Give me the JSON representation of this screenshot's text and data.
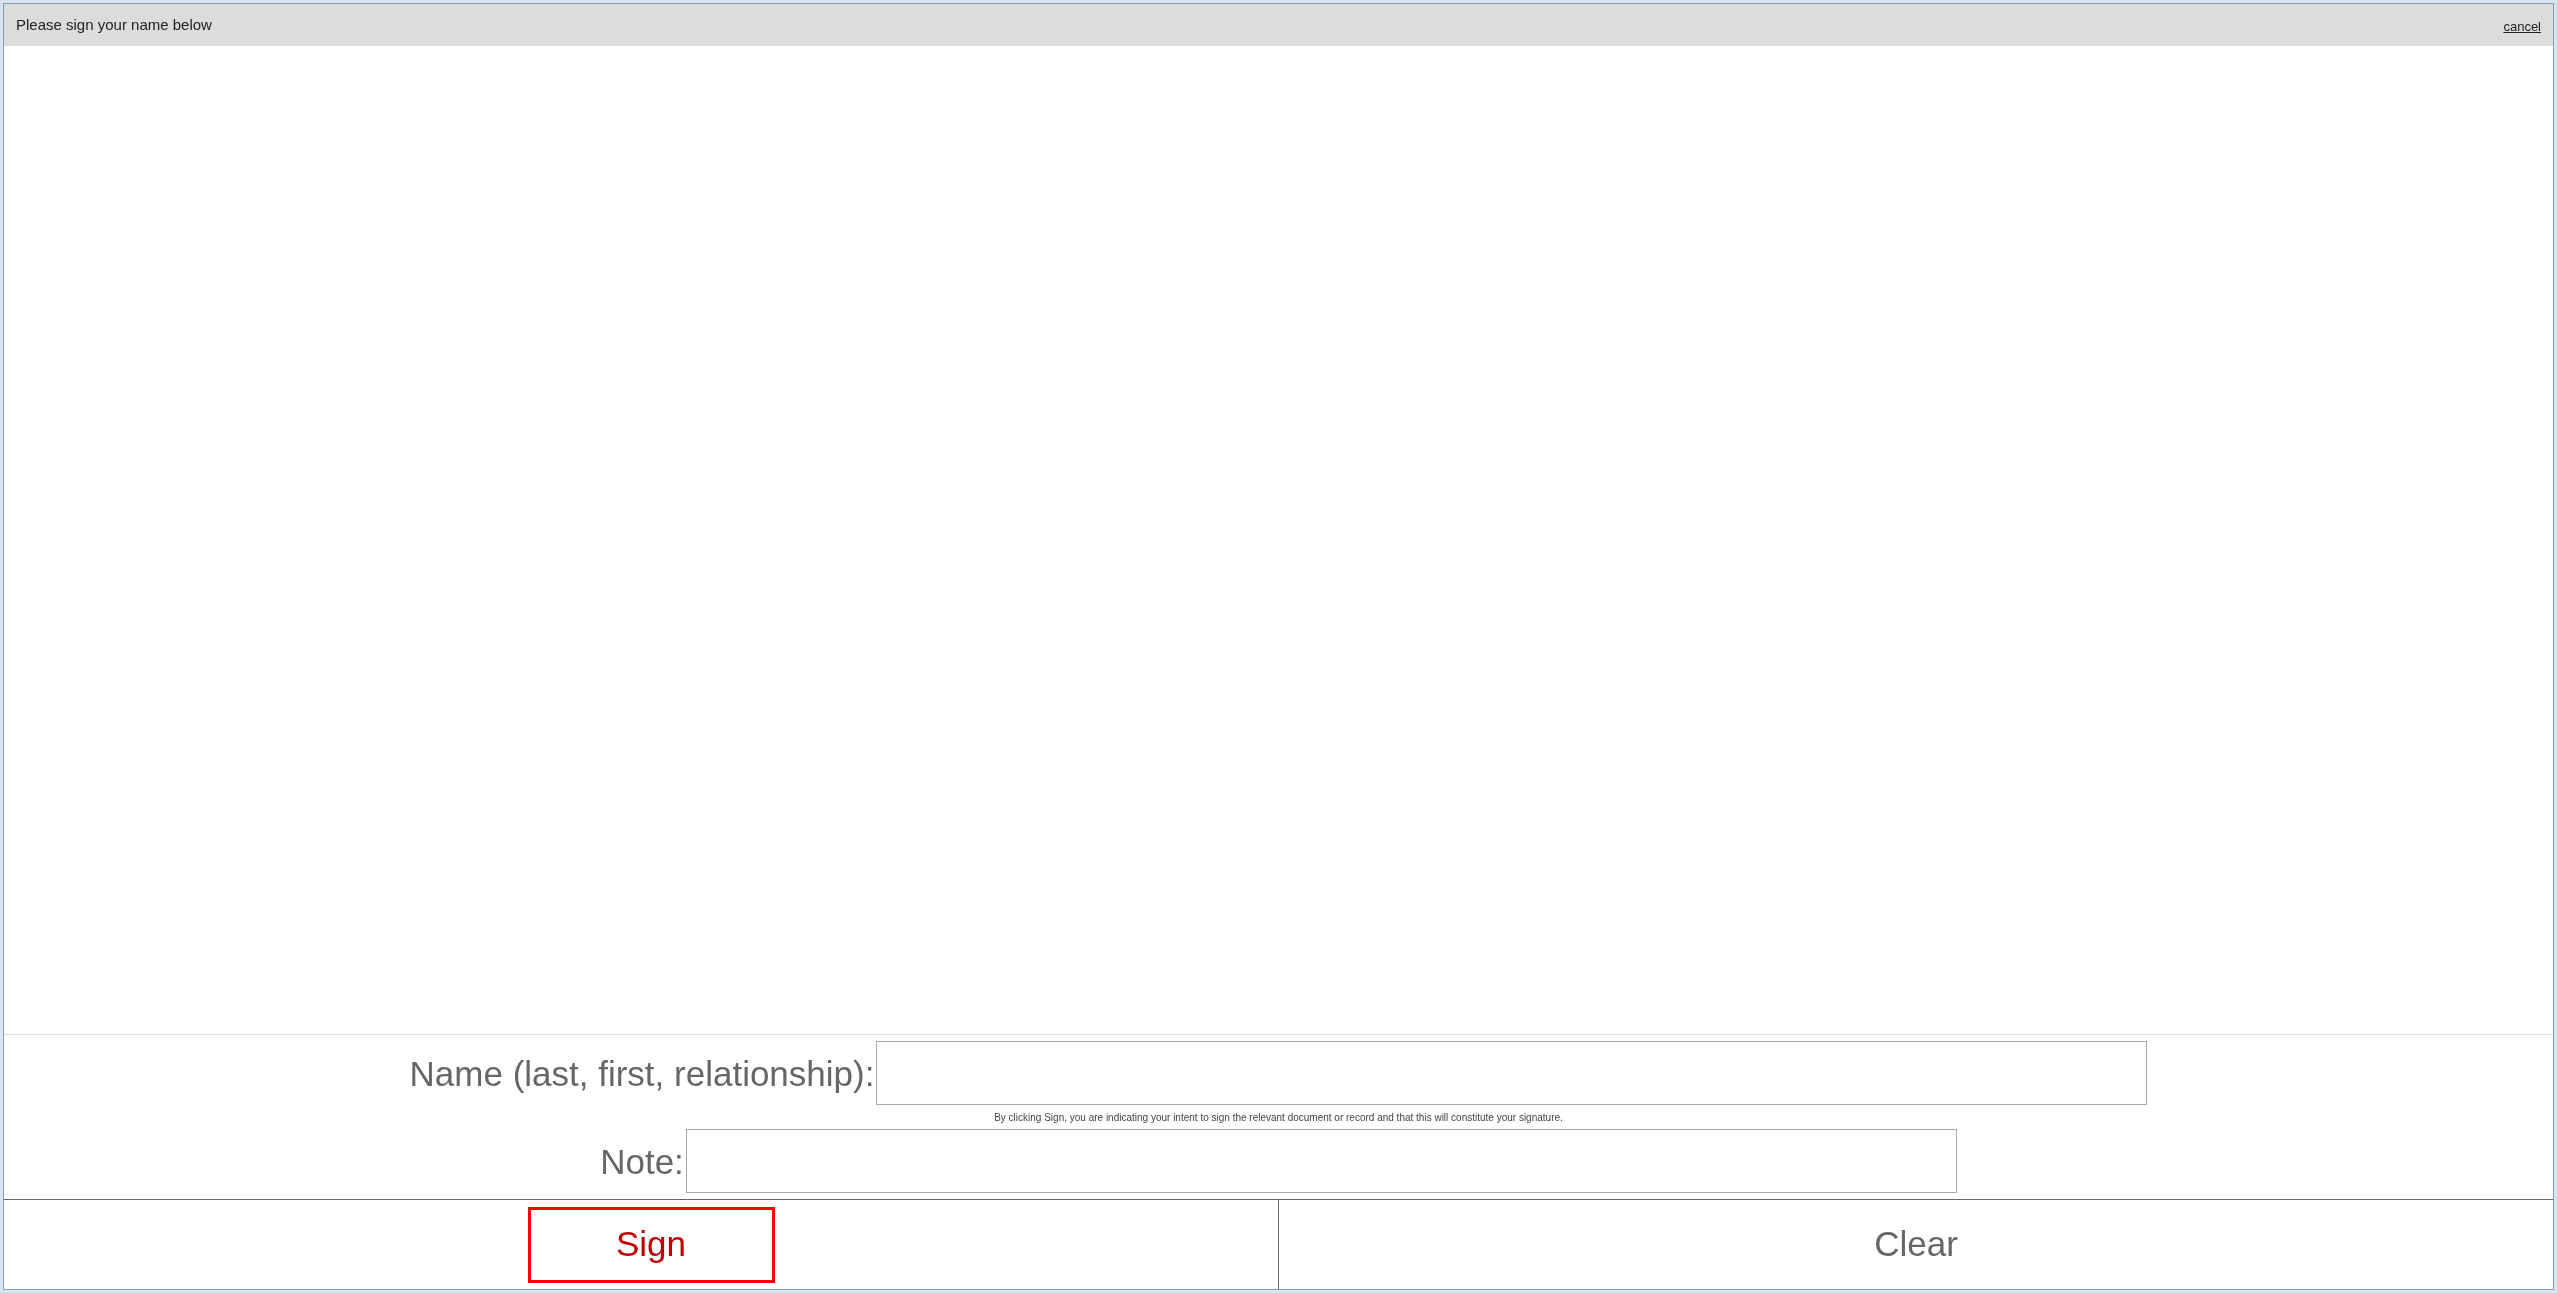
{
  "header": {
    "title": "Please sign your name below",
    "cancel": "cancel"
  },
  "fields": [
    {
      "label": "Name (last, first, relationship):"
    },
    {
      "label": "Note:"
    }
  ],
  "disclaimer": "By clicking Sign, you are indicating your intent to sign the relevant document or record and that this will constitute your signature.",
  "buttons": [
    {
      "label": "Sign",
      "selected": true
    },
    {
      "label": "Clear",
      "selected": false
    }
  ]
}
